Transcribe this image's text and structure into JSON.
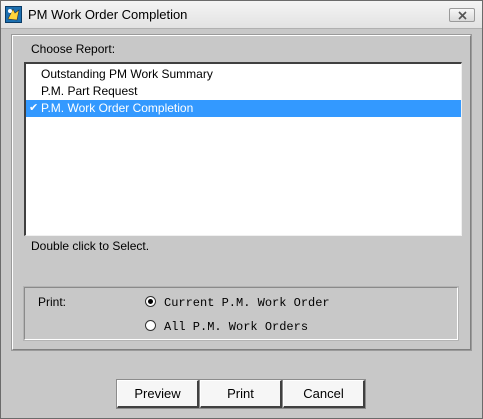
{
  "window": {
    "title": "PM Work Order Completion"
  },
  "report": {
    "label": "Choose Report:",
    "items": [
      {
        "label": "Outstanding PM Work Summary",
        "selected": false
      },
      {
        "label": "P.M. Part Request",
        "selected": false
      },
      {
        "label": "P.M. Work Order Completion",
        "selected": true
      }
    ],
    "hint": "Double click to Select.",
    "check_glyph": "✔"
  },
  "print": {
    "label": "Print:",
    "options": [
      {
        "label": "Current P.M. Work Order",
        "checked": true
      },
      {
        "label": "All P.M. Work Orders",
        "checked": false
      }
    ]
  },
  "buttons": {
    "preview": "Preview",
    "print": "Print",
    "cancel": "Cancel"
  },
  "colors": {
    "selection": "#3399ff",
    "window_bg": "#c8c8c8"
  },
  "icons": {
    "app": "app-icon",
    "close": "close-icon",
    "check": "check-icon"
  }
}
